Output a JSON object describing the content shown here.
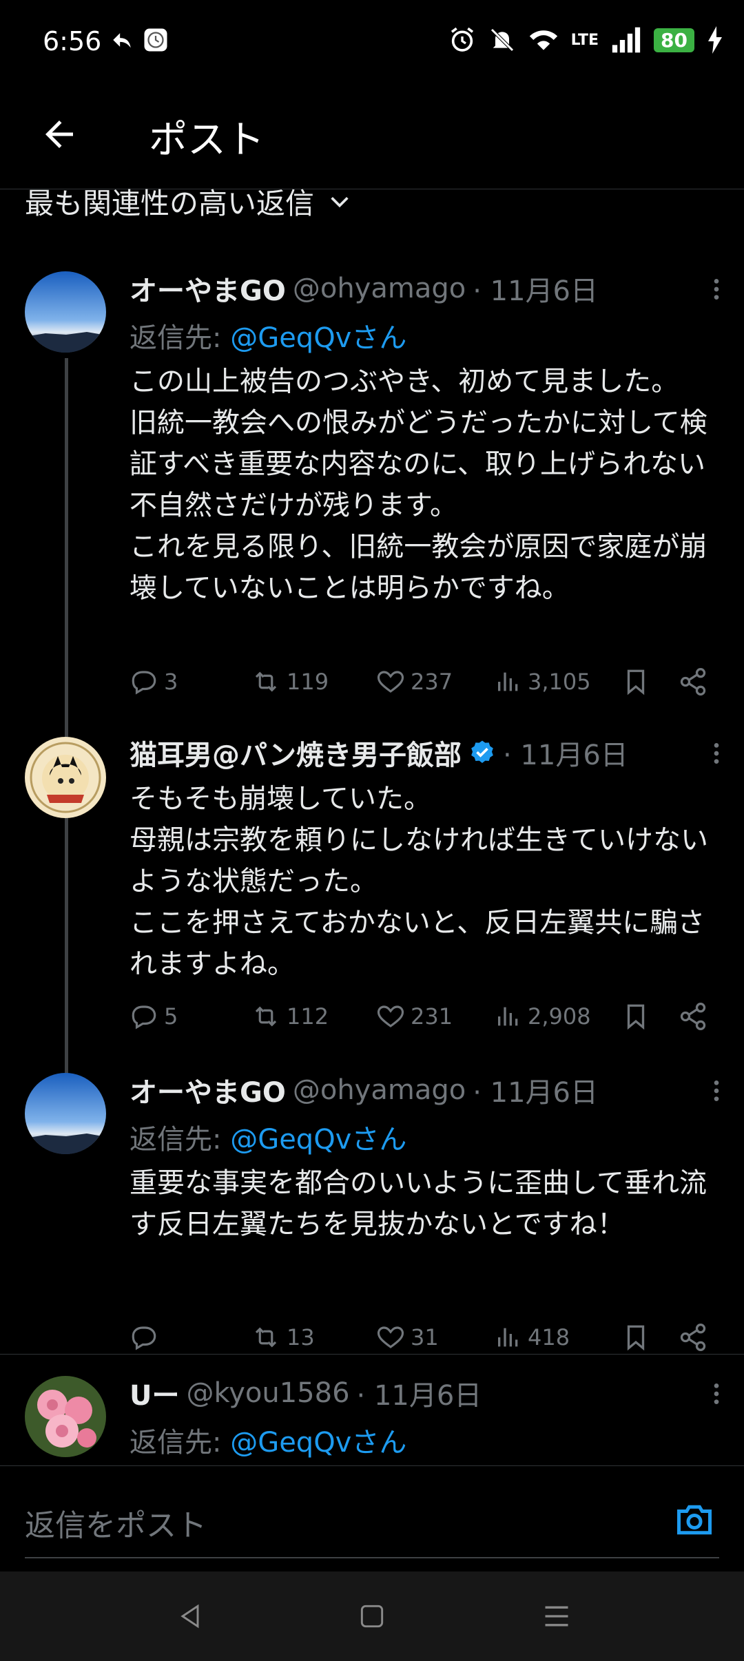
{
  "status": {
    "time": "6:56",
    "battery": "80",
    "network": "LTE"
  },
  "header": {
    "title": "ポスト",
    "back_icon": "arrow-left-icon"
  },
  "sort": {
    "label": "最も関連性の高い返信"
  },
  "colors": {
    "link": "#1d9bf0",
    "muted": "#71767b",
    "verified": "#1d9bf0"
  },
  "tweets": [
    {
      "name": "オーやまGO",
      "handle": "@ohyamago",
      "date": "· 11月6日",
      "reply_prefix": "返信先: ",
      "reply_to": "@GeqQvさん",
      "body": "この山上被告のつぶやき、初めて見ました。\n旧統一教会への恨みがどうだったかに対して検証すべき重要な内容なのに、取り上げられない不自然さだけが残ります。\nこれを見る限り、旧統一教会が原因で家庭が崩壊していないことは明らかですね。",
      "replies": "3",
      "reposts": "119",
      "likes": "237",
      "views": "3,105"
    },
    {
      "name": "猫耳男@パン焼き男子飯部",
      "handle": "",
      "date": "· 11月6日",
      "verified": true,
      "body": "そもそも崩壊していた。\n母親は宗教を頼りにしなければ生きていけないような状態だった。\nここを押さえておかないと、反日左翼共に騙されますよね。",
      "replies": "5",
      "reposts": "112",
      "likes": "231",
      "views": "2,908"
    },
    {
      "name": "オーやまGO",
      "handle": "@ohyamago",
      "date": "· 11月6日",
      "reply_prefix": "返信先: ",
      "reply_to": "@GeqQvさん",
      "body": "重要な事実を都合のいいように歪曲して垂れ流す反日左翼たちを見抜かないとですね！",
      "replies": "",
      "reposts": "13",
      "likes": "31",
      "views": "418"
    },
    {
      "name": "Uー",
      "handle": "@kyou1586",
      "date": "· 11月6日",
      "reply_prefix": "返信先: ",
      "reply_to": "@GeqQvさん"
    }
  ],
  "composer": {
    "placeholder": "返信をポスト"
  }
}
